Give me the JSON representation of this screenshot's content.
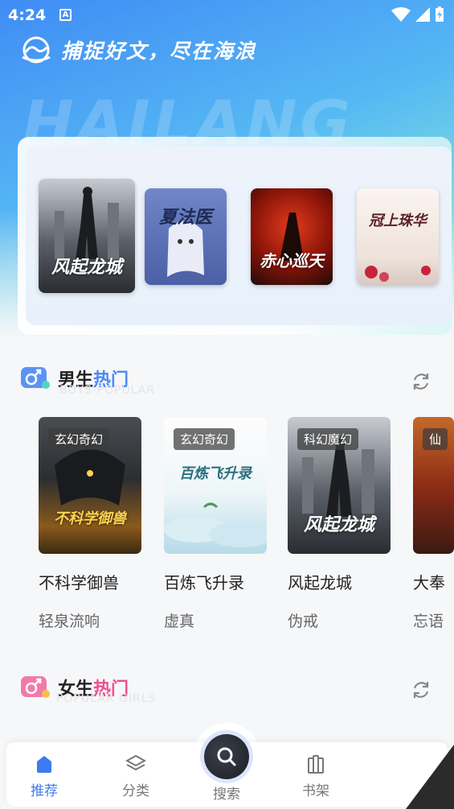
{
  "status": {
    "time": "4:24",
    "notif_glyph": "A"
  },
  "header": {
    "slogan": "捕捉好文，尽在海浪",
    "watermark": "HAILANG"
  },
  "carousel": {
    "books": [
      {
        "title": "风起龙城",
        "icon": "book-cover"
      },
      {
        "title": "夏法医",
        "icon": "book-cover"
      },
      {
        "title": "赤心巡天",
        "icon": "book-cover"
      },
      {
        "title": "冠上珠华",
        "icon": "book-cover"
      }
    ]
  },
  "boys": {
    "title_plain": "男生",
    "title_hot": "热门",
    "subtitle": "BOYS POPULAR",
    "books": [
      {
        "tag": "玄幻奇幻",
        "name": "不科学御兽",
        "author": "轻泉流响",
        "cover_text": "不科学御兽"
      },
      {
        "tag": "玄幻奇幻",
        "name": "百炼飞升录",
        "author": "虚真",
        "cover_text": "百炼飞升录"
      },
      {
        "tag": "科幻魔幻",
        "name": "风起龙城",
        "author": "伪戒",
        "cover_text": "风起龙城"
      },
      {
        "tag": "仙",
        "name": "大奉",
        "author": "忘语",
        "cover_text": ""
      }
    ]
  },
  "girls": {
    "title_plain": "女生",
    "title_hot": "热门",
    "subtitle": "POPULAR GIRLS"
  },
  "nav": {
    "recommend": "推荐",
    "category": "分类",
    "search": "搜索",
    "shelf": "书架"
  },
  "colors": {
    "accent": "#3d7bf0",
    "hot_blue": "#4a8af4",
    "hot_pink": "#ee4f8f"
  }
}
